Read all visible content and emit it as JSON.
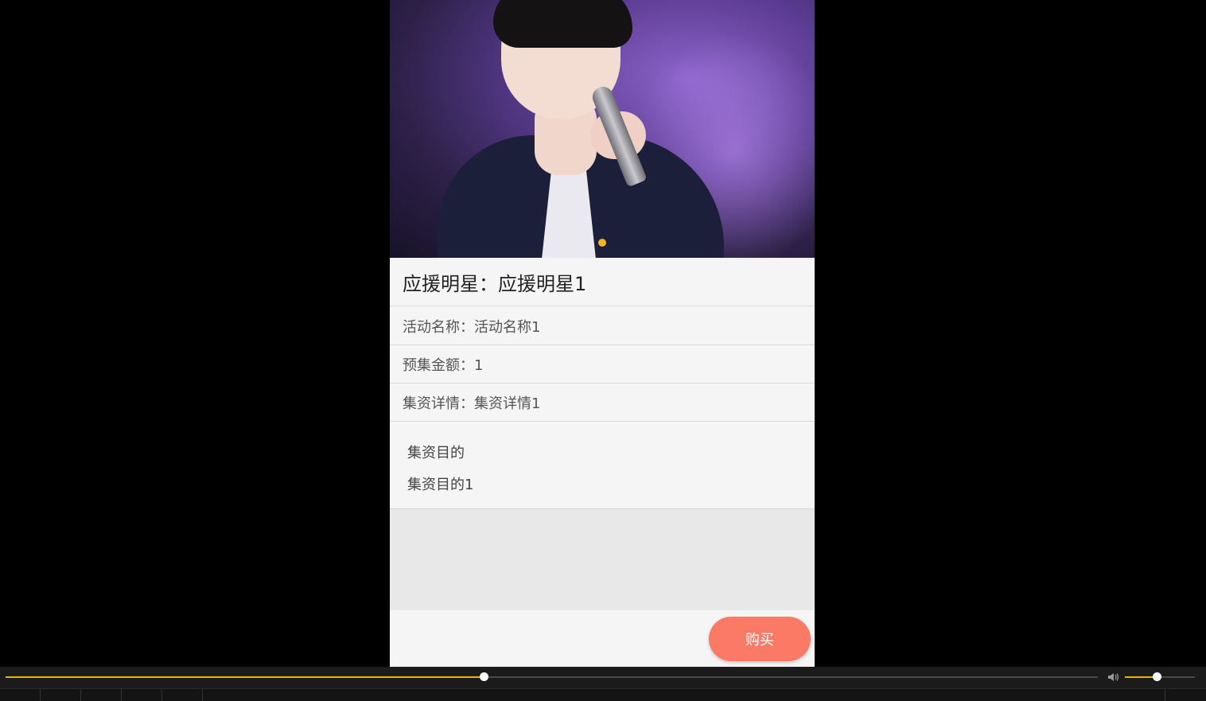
{
  "detail": {
    "title": "应援明星：应援明星1",
    "activity_label": "活动名称：活动名称1",
    "amount_label": "预集金额：1",
    "details_label": "集资详情：集资详情1",
    "purpose_heading": "集资目的",
    "purpose_value": "集资目的1"
  },
  "actions": {
    "buy_label": "购买"
  },
  "player": {
    "seek_progress": 0.438,
    "volume_level": 0.45,
    "accent_color": "#e6b800",
    "volume_icon": "speaker-icon"
  },
  "colors": {
    "buy_button": "#fa7a66",
    "page_bg": "#f5f5f5"
  }
}
